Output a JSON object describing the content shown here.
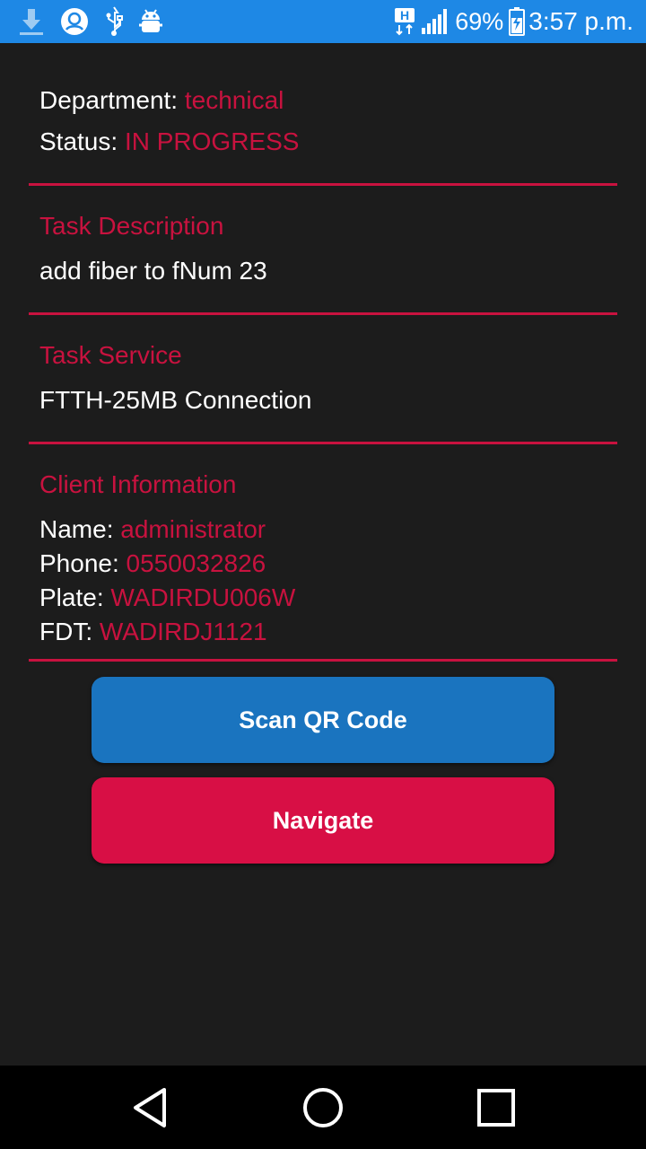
{
  "status_bar": {
    "signal_label": "H",
    "battery_percent": "69%",
    "time": "3:57 p.m.",
    "battery_level": 0.69,
    "icons": [
      "download-icon",
      "vpn-globe-icon",
      "usb-icon",
      "android-debug-icon",
      "hd-signal-icon",
      "cellular-signal-icon",
      "battery-charging-icon"
    ]
  },
  "task": {
    "department_label": "Department:",
    "department_value": "technical",
    "status_label": "Status:",
    "status_value": "IN PROGRESS"
  },
  "description": {
    "heading": "Task Description",
    "text": "add fiber to fNum 23"
  },
  "service": {
    "heading": "Task Service",
    "text": "FTTH-25MB Connection"
  },
  "client": {
    "heading": "Client Information",
    "name_label": "Name:",
    "name_value": "administrator",
    "phone_label": "Phone:",
    "phone_value": "0550032826",
    "plate_label": "Plate:",
    "plate_value": "WADIRDU006W",
    "fdt_label": "FDT:",
    "fdt_value": "WADIRDJ1121"
  },
  "actions": {
    "scan_label": "Scan QR Code",
    "navigate_label": "Navigate"
  },
  "colors": {
    "status_bar": "#1e88e5",
    "accent": "#c8123f",
    "scan_button": "#1a74bf",
    "navigate_button": "#d80f45",
    "background": "#1c1c1c"
  }
}
